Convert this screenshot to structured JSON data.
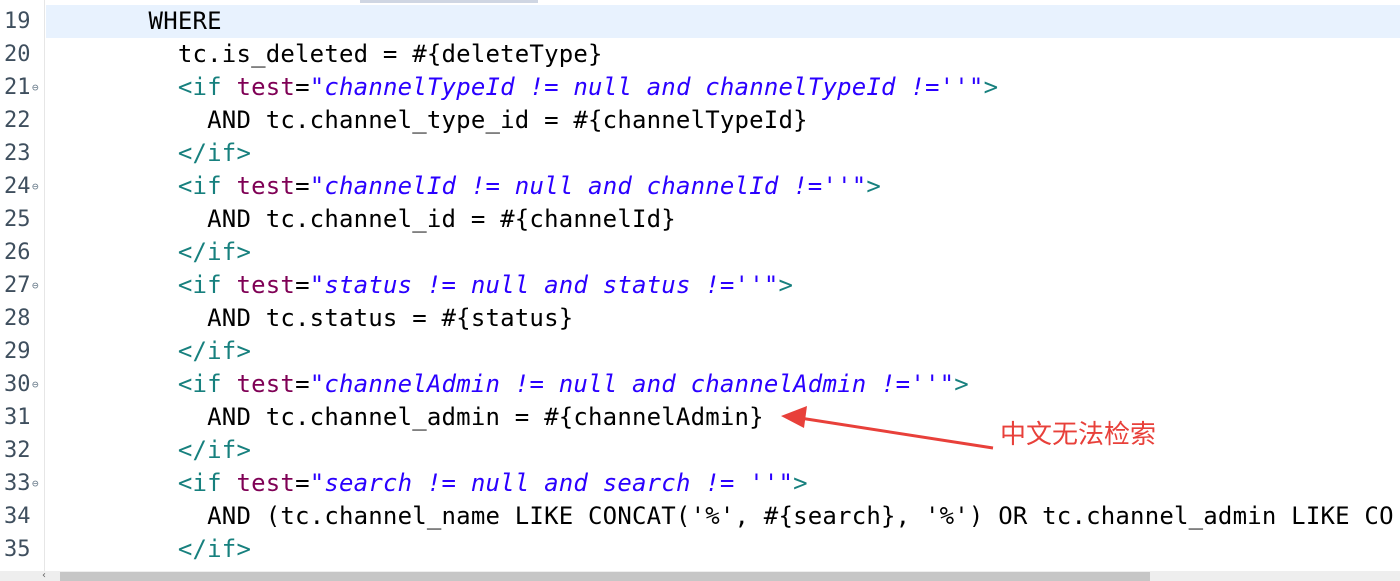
{
  "editor": {
    "lines": [
      {
        "num": "19",
        "fold": "",
        "segments": [
          {
            "t": "plain",
            "v": "       WHERE"
          }
        ]
      },
      {
        "num": "20",
        "fold": "",
        "segments": [
          {
            "t": "plain",
            "v": "         tc.is_deleted = #{deleteType}"
          }
        ]
      },
      {
        "num": "21",
        "fold": "⊖",
        "segments": [
          {
            "t": "plain",
            "v": "         "
          },
          {
            "t": "tag",
            "v": "<if "
          },
          {
            "t": "attr",
            "v": "test"
          },
          {
            "t": "eq",
            "v": "="
          },
          {
            "t": "val",
            "v": "\"channelTypeId != null and channelTypeId !=''\""
          },
          {
            "t": "tag",
            "v": ">"
          }
        ]
      },
      {
        "num": "22",
        "fold": "",
        "segments": [
          {
            "t": "plain",
            "v": "           AND tc.channel_type_id = #{channelTypeId}"
          }
        ]
      },
      {
        "num": "23",
        "fold": "",
        "segments": [
          {
            "t": "plain",
            "v": "         "
          },
          {
            "t": "tag",
            "v": "</if>"
          }
        ]
      },
      {
        "num": "24",
        "fold": "⊖",
        "segments": [
          {
            "t": "plain",
            "v": "         "
          },
          {
            "t": "tag",
            "v": "<if "
          },
          {
            "t": "attr",
            "v": "test"
          },
          {
            "t": "eq",
            "v": "="
          },
          {
            "t": "val",
            "v": "\"channelId != null and channelId !=''\""
          },
          {
            "t": "tag",
            "v": ">"
          }
        ]
      },
      {
        "num": "25",
        "fold": "",
        "segments": [
          {
            "t": "plain",
            "v": "           AND tc.channel_id = #{channelId}"
          }
        ]
      },
      {
        "num": "26",
        "fold": "",
        "segments": [
          {
            "t": "plain",
            "v": "         "
          },
          {
            "t": "tag",
            "v": "</if>"
          }
        ]
      },
      {
        "num": "27",
        "fold": "⊖",
        "segments": [
          {
            "t": "plain",
            "v": "         "
          },
          {
            "t": "tag",
            "v": "<if "
          },
          {
            "t": "attr",
            "v": "test"
          },
          {
            "t": "eq",
            "v": "="
          },
          {
            "t": "val",
            "v": "\"status != null and status !=''\""
          },
          {
            "t": "tag",
            "v": ">"
          }
        ]
      },
      {
        "num": "28",
        "fold": "",
        "segments": [
          {
            "t": "plain",
            "v": "           AND tc.status = #{status}"
          }
        ]
      },
      {
        "num": "29",
        "fold": "",
        "segments": [
          {
            "t": "plain",
            "v": "         "
          },
          {
            "t": "tag",
            "v": "</if>"
          }
        ]
      },
      {
        "num": "30",
        "fold": "⊖",
        "segments": [
          {
            "t": "plain",
            "v": "         "
          },
          {
            "t": "tag",
            "v": "<if "
          },
          {
            "t": "attr",
            "v": "test"
          },
          {
            "t": "eq",
            "v": "="
          },
          {
            "t": "val",
            "v": "\"channelAdmin != null and channelAdmin !=''\""
          },
          {
            "t": "tag",
            "v": ">"
          }
        ]
      },
      {
        "num": "31",
        "fold": "",
        "segments": [
          {
            "t": "plain",
            "v": "           AND tc.channel_admin = #{channelAdmin}"
          }
        ]
      },
      {
        "num": "32",
        "fold": "",
        "segments": [
          {
            "t": "plain",
            "v": "         "
          },
          {
            "t": "tag",
            "v": "</if>"
          }
        ]
      },
      {
        "num": "33",
        "fold": "⊖",
        "segments": [
          {
            "t": "plain",
            "v": "         "
          },
          {
            "t": "tag",
            "v": "<if "
          },
          {
            "t": "attr",
            "v": "test"
          },
          {
            "t": "eq",
            "v": "="
          },
          {
            "t": "val",
            "v": "\"search != null and search != ''\""
          },
          {
            "t": "tag",
            "v": ">"
          }
        ]
      },
      {
        "num": "34",
        "fold": "",
        "segments": [
          {
            "t": "plain",
            "v": "           AND (tc.channel_name LIKE CONCAT('%', #{search}, '%') OR tc.channel_admin LIKE CO"
          }
        ]
      },
      {
        "num": "35",
        "fold": "",
        "segments": [
          {
            "t": "plain",
            "v": "         "
          },
          {
            "t": "tag",
            "v": "</if>"
          }
        ]
      }
    ],
    "current_line": "19"
  },
  "annotation": {
    "text": "中文无法检索",
    "color": "#e8403a"
  },
  "colors": {
    "tag": "#17807e",
    "attr": "#7f0055",
    "value": "#2a00ff",
    "current_line_bg": "#e8f2fe"
  }
}
